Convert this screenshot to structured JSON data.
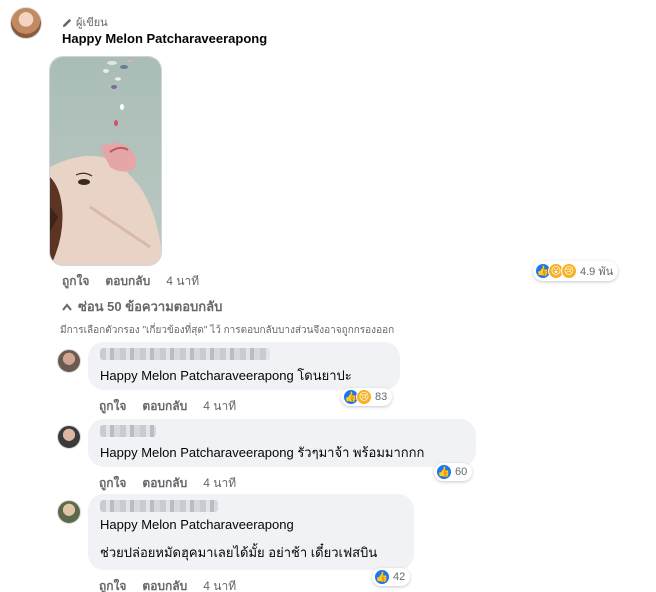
{
  "main_comment": {
    "author_badge": "ผู้เขียน",
    "author_name": "Happy Melon Patcharaveerapong",
    "actions": {
      "like": "ถูกใจ",
      "reply": "ตอบกลับ",
      "time": "4 นาที"
    },
    "reactions": {
      "count": "4.9 พัน",
      "icons": [
        "like-icon",
        "wow-icon",
        "sad-icon"
      ]
    }
  },
  "hide_replies_label": "ซ่อน 50 ข้อความตอบกลับ",
  "filter_note": "มีการเลือกตัวกรอง \"เกี่ยวข้องที่สุด\" ไว้ การตอบกลับบางส่วนจึงอาจถูกกรองออก",
  "replies": [
    {
      "tag": "Happy Melon Patcharaveerapong",
      "text": "โดนยาปะ",
      "reaction_count": "83",
      "icons": [
        "like-icon",
        "sad-icon"
      ],
      "actions": {
        "like": "ถูกใจ",
        "reply": "ตอบกลับ",
        "time": "4 นาที"
      }
    },
    {
      "tag": "Happy Melon Patcharaveerapong",
      "text": "รัวๆมาจ้า พร้อมมากกก",
      "reaction_count": "60",
      "icons": [
        "like-icon"
      ],
      "actions": {
        "like": "ถูกใจ",
        "reply": "ตอบกลับ",
        "time": "4 นาที"
      }
    },
    {
      "tag": "Happy Melon Patcharaveerapong",
      "text": "ช่วยปล่อยหมัดฮุคมาเลยได้มั้ย อย่าช้า เดี๋ยวเฟสบิน",
      "reaction_count": "42",
      "icons": [
        "like-icon"
      ],
      "actions": {
        "like": "ถูกใจ",
        "reply": "ตอบกลับ",
        "time": "4 นาที"
      }
    }
  ]
}
